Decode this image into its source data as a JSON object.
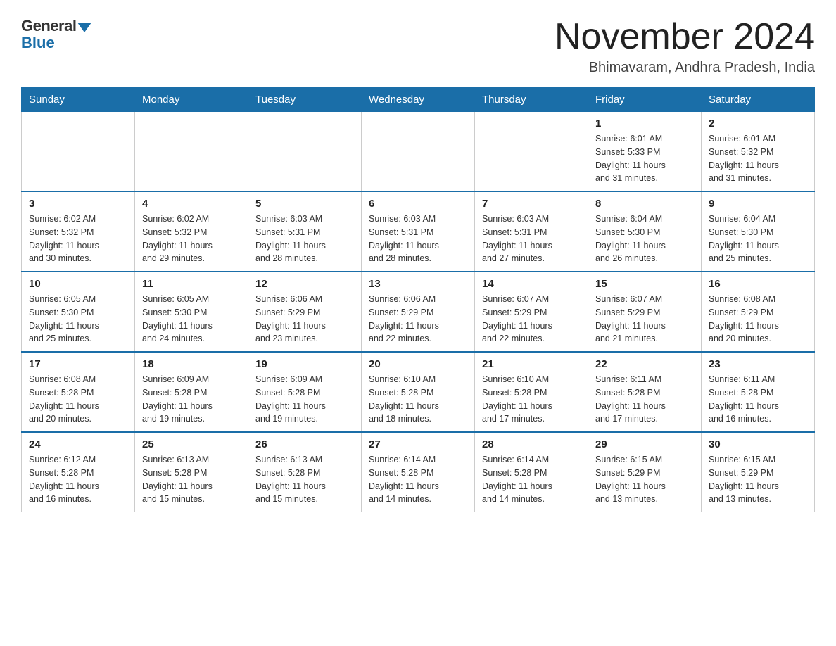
{
  "header": {
    "logo_general": "General",
    "logo_blue": "Blue",
    "month_title": "November 2024",
    "location": "Bhimavaram, Andhra Pradesh, India"
  },
  "weekdays": [
    "Sunday",
    "Monday",
    "Tuesday",
    "Wednesday",
    "Thursday",
    "Friday",
    "Saturday"
  ],
  "weeks": [
    [
      {
        "num": "",
        "info": ""
      },
      {
        "num": "",
        "info": ""
      },
      {
        "num": "",
        "info": ""
      },
      {
        "num": "",
        "info": ""
      },
      {
        "num": "",
        "info": ""
      },
      {
        "num": "1",
        "info": "Sunrise: 6:01 AM\nSunset: 5:33 PM\nDaylight: 11 hours\nand 31 minutes."
      },
      {
        "num": "2",
        "info": "Sunrise: 6:01 AM\nSunset: 5:32 PM\nDaylight: 11 hours\nand 31 minutes."
      }
    ],
    [
      {
        "num": "3",
        "info": "Sunrise: 6:02 AM\nSunset: 5:32 PM\nDaylight: 11 hours\nand 30 minutes."
      },
      {
        "num": "4",
        "info": "Sunrise: 6:02 AM\nSunset: 5:32 PM\nDaylight: 11 hours\nand 29 minutes."
      },
      {
        "num": "5",
        "info": "Sunrise: 6:03 AM\nSunset: 5:31 PM\nDaylight: 11 hours\nand 28 minutes."
      },
      {
        "num": "6",
        "info": "Sunrise: 6:03 AM\nSunset: 5:31 PM\nDaylight: 11 hours\nand 28 minutes."
      },
      {
        "num": "7",
        "info": "Sunrise: 6:03 AM\nSunset: 5:31 PM\nDaylight: 11 hours\nand 27 minutes."
      },
      {
        "num": "8",
        "info": "Sunrise: 6:04 AM\nSunset: 5:30 PM\nDaylight: 11 hours\nand 26 minutes."
      },
      {
        "num": "9",
        "info": "Sunrise: 6:04 AM\nSunset: 5:30 PM\nDaylight: 11 hours\nand 25 minutes."
      }
    ],
    [
      {
        "num": "10",
        "info": "Sunrise: 6:05 AM\nSunset: 5:30 PM\nDaylight: 11 hours\nand 25 minutes."
      },
      {
        "num": "11",
        "info": "Sunrise: 6:05 AM\nSunset: 5:30 PM\nDaylight: 11 hours\nand 24 minutes."
      },
      {
        "num": "12",
        "info": "Sunrise: 6:06 AM\nSunset: 5:29 PM\nDaylight: 11 hours\nand 23 minutes."
      },
      {
        "num": "13",
        "info": "Sunrise: 6:06 AM\nSunset: 5:29 PM\nDaylight: 11 hours\nand 22 minutes."
      },
      {
        "num": "14",
        "info": "Sunrise: 6:07 AM\nSunset: 5:29 PM\nDaylight: 11 hours\nand 22 minutes."
      },
      {
        "num": "15",
        "info": "Sunrise: 6:07 AM\nSunset: 5:29 PM\nDaylight: 11 hours\nand 21 minutes."
      },
      {
        "num": "16",
        "info": "Sunrise: 6:08 AM\nSunset: 5:29 PM\nDaylight: 11 hours\nand 20 minutes."
      }
    ],
    [
      {
        "num": "17",
        "info": "Sunrise: 6:08 AM\nSunset: 5:28 PM\nDaylight: 11 hours\nand 20 minutes."
      },
      {
        "num": "18",
        "info": "Sunrise: 6:09 AM\nSunset: 5:28 PM\nDaylight: 11 hours\nand 19 minutes."
      },
      {
        "num": "19",
        "info": "Sunrise: 6:09 AM\nSunset: 5:28 PM\nDaylight: 11 hours\nand 19 minutes."
      },
      {
        "num": "20",
        "info": "Sunrise: 6:10 AM\nSunset: 5:28 PM\nDaylight: 11 hours\nand 18 minutes."
      },
      {
        "num": "21",
        "info": "Sunrise: 6:10 AM\nSunset: 5:28 PM\nDaylight: 11 hours\nand 17 minutes."
      },
      {
        "num": "22",
        "info": "Sunrise: 6:11 AM\nSunset: 5:28 PM\nDaylight: 11 hours\nand 17 minutes."
      },
      {
        "num": "23",
        "info": "Sunrise: 6:11 AM\nSunset: 5:28 PM\nDaylight: 11 hours\nand 16 minutes."
      }
    ],
    [
      {
        "num": "24",
        "info": "Sunrise: 6:12 AM\nSunset: 5:28 PM\nDaylight: 11 hours\nand 16 minutes."
      },
      {
        "num": "25",
        "info": "Sunrise: 6:13 AM\nSunset: 5:28 PM\nDaylight: 11 hours\nand 15 minutes."
      },
      {
        "num": "26",
        "info": "Sunrise: 6:13 AM\nSunset: 5:28 PM\nDaylight: 11 hours\nand 15 minutes."
      },
      {
        "num": "27",
        "info": "Sunrise: 6:14 AM\nSunset: 5:28 PM\nDaylight: 11 hours\nand 14 minutes."
      },
      {
        "num": "28",
        "info": "Sunrise: 6:14 AM\nSunset: 5:28 PM\nDaylight: 11 hours\nand 14 minutes."
      },
      {
        "num": "29",
        "info": "Sunrise: 6:15 AM\nSunset: 5:29 PM\nDaylight: 11 hours\nand 13 minutes."
      },
      {
        "num": "30",
        "info": "Sunrise: 6:15 AM\nSunset: 5:29 PM\nDaylight: 11 hours\nand 13 minutes."
      }
    ]
  ]
}
